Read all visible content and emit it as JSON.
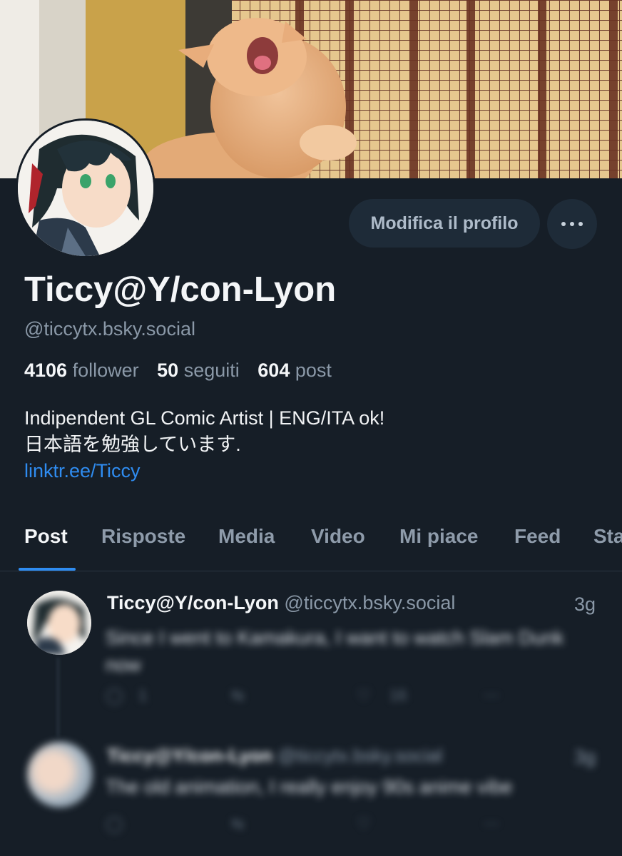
{
  "profile": {
    "display_name": "Ticcy@Y/con-Lyon",
    "handle": "@ticcytx.bsky.social",
    "edit_button": "Modifica il profilo",
    "more_icon": "ellipsis-icon",
    "stats": {
      "followers_count": "4106",
      "followers_label": "follower",
      "following_count": "50",
      "following_label": "seguiti",
      "posts_count": "604",
      "posts_label": "post"
    },
    "bio_line1": "Indipendent GL Comic Artist | ENG/ITA ok!",
    "bio_line2": "日本語を勉強しています.",
    "bio_link": "linktr.ee/Ticcy"
  },
  "tabs": [
    {
      "label": "Post",
      "active": true
    },
    {
      "label": "Risposte"
    },
    {
      "label": "Media"
    },
    {
      "label": "Video"
    },
    {
      "label": "Mi piace"
    },
    {
      "label": "Feed"
    },
    {
      "label": "Sta"
    }
  ],
  "feed": {
    "post1": {
      "author": "Ticcy@Y/con-Lyon",
      "handle": "@ticcytx.bsky.social",
      "time": "3g",
      "text": "Since I went to Kamakura, I want to watch Slam Dunk now",
      "reply_count": "1",
      "like_count": "16"
    },
    "post2": {
      "author": "Ticcy@Y/con-Lyon",
      "handle": "@ticcytx.bsky.social",
      "time": "3g",
      "text": "The old animation, I really enjoy 90s anime vibe"
    }
  },
  "colors": {
    "background": "#161e27",
    "accent": "#2f8cf0",
    "button_bg": "#1e2b38",
    "muted_text": "#8a98a7"
  }
}
